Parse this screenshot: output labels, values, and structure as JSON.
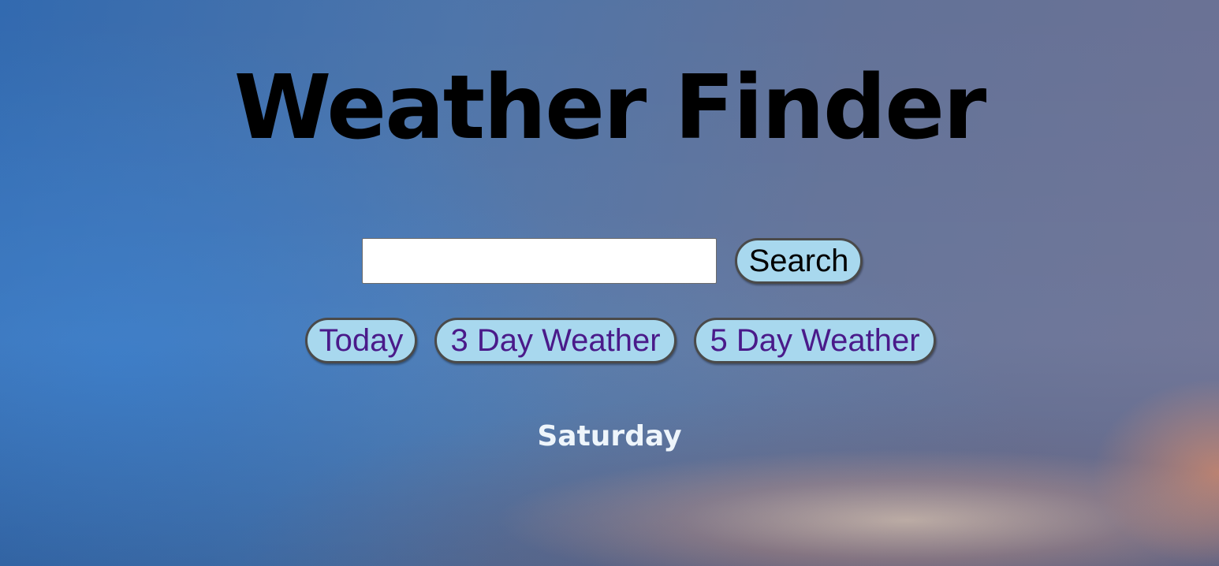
{
  "header": {
    "title": "Weather Finder"
  },
  "search": {
    "value": "",
    "placeholder": "",
    "button_label": "Search"
  },
  "nav": {
    "today_label": "Today",
    "three_day_label": "3 Day Weather",
    "five_day_label": "5 Day Weather"
  },
  "forecast": {
    "day": "Saturday"
  },
  "colors": {
    "button_background": "#a8d8ee",
    "nav_text": "#4a1a8a",
    "title_text": "#000000",
    "day_text": "#eef5fb"
  }
}
